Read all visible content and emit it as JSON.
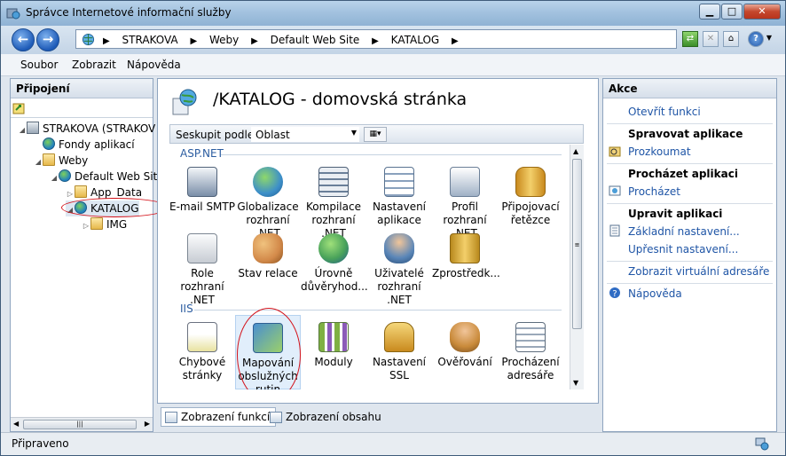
{
  "window": {
    "title": "Správce Internetové informační služby"
  },
  "address": {
    "crumbs": [
      "STRAKOVA",
      "Weby",
      "Default Web Site",
      "KATALOG"
    ]
  },
  "menu": [
    "Soubor",
    "Zobrazit",
    "Nápověda"
  ],
  "connections": {
    "title": "Připojení",
    "tree": [
      {
        "label": "STRAKOVA (STRAKOV",
        "icon": "server-icon"
      },
      {
        "label": "Fondy aplikací",
        "icon": "app-pool-icon"
      },
      {
        "label": "Weby",
        "icon": "sites-icon"
      },
      {
        "label": "Default Web Sit",
        "icon": "globe-icon"
      },
      {
        "label": "App_Data",
        "icon": "folder-icon"
      },
      {
        "label": "KATALOG",
        "icon": "globe-icon"
      },
      {
        "label": "IMG",
        "icon": "folder-icon"
      }
    ]
  },
  "center": {
    "title": "/KATALOG - domovská stránka",
    "group_label": "Seskupit podle:",
    "group_value": "Oblast",
    "sections": {
      "aspnet": "ASP.NET",
      "iis": "IIS"
    },
    "aspnet_features": [
      {
        "line1": "E-mail SMTP",
        "line2": "",
        "icon": "email-icon",
        "color": "#7a8ea8"
      },
      {
        "line1": "Globalizace",
        "line2": "rozhraní .NET",
        "icon": "globe-icon",
        "color": "#3d8fc9"
      },
      {
        "line1": "Kompilace",
        "line2": "rozhraní .NET",
        "icon": "stack-icon",
        "color": "#6a7f99"
      },
      {
        "line1": "Nastavení",
        "line2": "aplikace",
        "icon": "settings-list-icon",
        "color": "#8aa1bd"
      },
      {
        "line1": "Profil",
        "line2": "rozhraní .NET",
        "icon": "profile-icon",
        "color": "#9fb1c6"
      },
      {
        "line1": "Připojovací",
        "line2": "řetězce",
        "icon": "database-icon",
        "color": "#e8b33c"
      },
      {
        "line1": "Role rozhraní",
        "line2": ".NET",
        "icon": "roles-icon",
        "color": "#c7ccd3"
      },
      {
        "line1": "Stav relace",
        "line2": "",
        "icon": "session-icon",
        "color": "#d38a4a"
      },
      {
        "line1": "Úrovně",
        "line2": "důvěryhod...",
        "icon": "trust-globe-icon",
        "color": "#4aa35a"
      },
      {
        "line1": "Uživatelé",
        "line2": "rozhraní .NET",
        "icon": "users-icon",
        "color": "#5a86b8"
      },
      {
        "line1": "Zprostředk...",
        "line2": "",
        "icon": "provider-icon",
        "color": "#d9a83a"
      }
    ],
    "iis_features": [
      {
        "line1": "Chybové",
        "line2": "stránky",
        "line3": "",
        "icon": "error-page-icon",
        "color": "#d6d06a"
      },
      {
        "line1": "Mapování",
        "line2": "obslužných",
        "line3": "rutin",
        "icon": "handler-mapping-icon",
        "color": "#4a8fd0"
      },
      {
        "line1": "Moduly",
        "line2": "",
        "line3": "",
        "icon": "modules-icon",
        "color": "#7fb043"
      },
      {
        "line1": "Nastavení",
        "line2": "SSL",
        "line3": "",
        "icon": "ssl-lock-icon",
        "color": "#d9a83a"
      },
      {
        "line1": "Ověřování",
        "line2": "",
        "line3": "",
        "icon": "auth-icon",
        "color": "#c98a3a"
      },
      {
        "line1": "Procházení",
        "line2": "adresáře",
        "line3": "",
        "icon": "dir-browse-icon",
        "color": "#9aa8b9"
      }
    ]
  },
  "view_tabs": {
    "features": "Zobrazení funkcí",
    "content": "Zobrazení obsahu"
  },
  "actions": {
    "title": "Akce",
    "open_features": "Otevřít funkci",
    "manage_app": "Spravovat aplikace",
    "browse_perm": "Prozkoumat",
    "browse_app": "Procházet aplikaci",
    "browse": "Procházet",
    "edit_app": "Upravit aplikaci",
    "basic": "Základní nastavení...",
    "advanced": "Upřesnit nastavení...",
    "virtual_dirs": "Zobrazit virtuální adresáře",
    "help": "Nápověda"
  },
  "status": {
    "text": "Připraveno"
  }
}
